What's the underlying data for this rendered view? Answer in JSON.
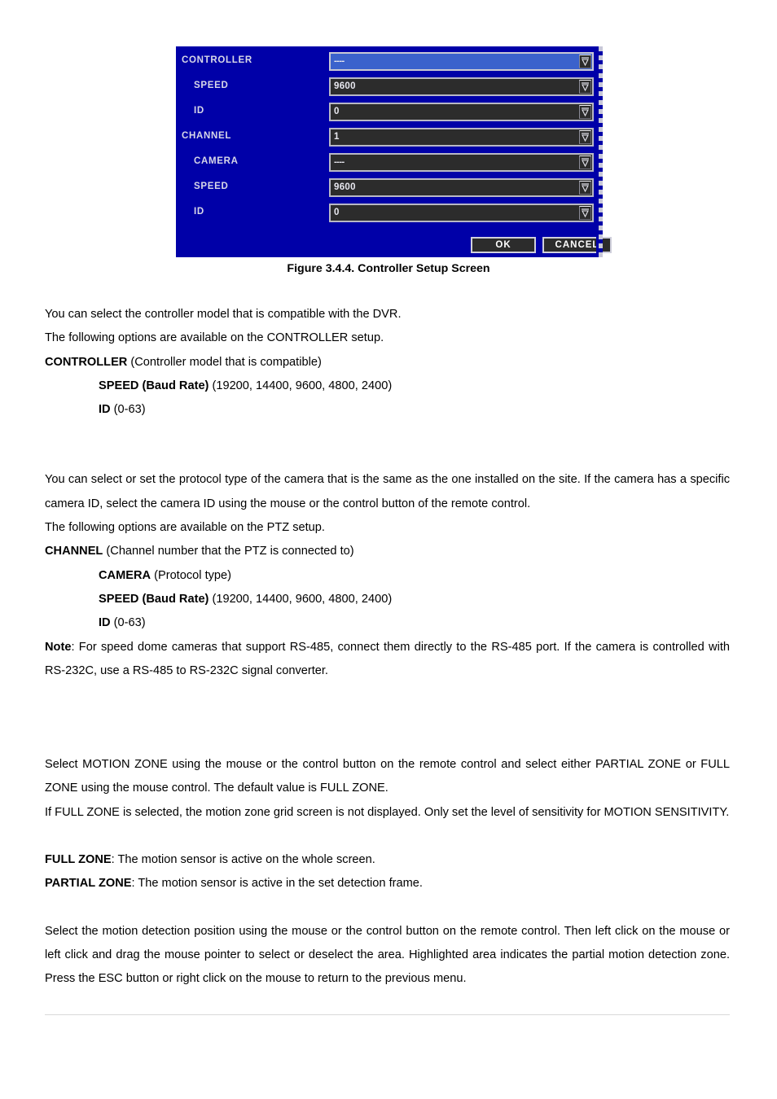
{
  "figure": {
    "caption": "Figure 3.4.4. Controller Setup Screen",
    "dialog": {
      "background_color": "#0000A8",
      "field_background_color": "#2C2C2C",
      "selected_field_color": "#3B62CC",
      "rows": [
        {
          "label": "CONTROLLER",
          "level": 0,
          "value": "----",
          "selected": true,
          "icon": "chevron-down-icon"
        },
        {
          "label": "SPEED",
          "level": 1,
          "value": "9600",
          "selected": false,
          "icon": "chevron-down-icon"
        },
        {
          "label": "ID",
          "level": 1,
          "value": "0",
          "selected": false,
          "icon": "chevron-down-icon"
        },
        {
          "label": "CHANNEL",
          "level": 0,
          "value": "1",
          "selected": false,
          "icon": "chevron-down-icon"
        },
        {
          "label": "CAMERA",
          "level": 1,
          "value": "----",
          "selected": false,
          "icon": "chevron-down-icon"
        },
        {
          "label": "SPEED",
          "level": 1,
          "value": "9600",
          "selected": false,
          "icon": "chevron-down-icon"
        },
        {
          "label": "ID",
          "level": 1,
          "value": "0",
          "selected": false,
          "icon": "chevron-down-icon"
        }
      ],
      "buttons": {
        "ok": "OK",
        "cancel": "CANCEL"
      }
    }
  },
  "body": {
    "para1_line1": "You can select the controller model that is compatible with the DVR.",
    "para1_line2": "The following options are available on the CONTROLLER setup.",
    "controller_term": "CONTROLLER",
    "controller_desc": " (Controller model that is compatible)",
    "speed_term_1": "SPEED (Baud Rate)",
    "speed_desc_1": " (19200, 14400, 9600, 4800, 2400)",
    "id_term_1": "ID",
    "id_desc_1": " (0-63)",
    "para2": "You can select or set the protocol type of the camera that is the same as the one installed on the site. If the camera has a specific camera ID, select the camera ID using the mouse or the control button of the remote control.",
    "para2_line3": "The following options are available on the PTZ setup.",
    "channel_term": "CHANNEL",
    "channel_desc": " (Channel number that the PTZ is connected to)",
    "camera_term": "CAMERA",
    "camera_desc": " (Protocol type)",
    "speed_term_2": "SPEED (Baud Rate)",
    "speed_desc_2": " (19200, 14400, 9600, 4800, 2400)",
    "id_term_2": "ID",
    "id_desc_2": " (0-63)",
    "note_term": "Note",
    "note_desc": ": For speed dome cameras that support RS-485, connect them directly to the RS-485 port. If the camera is controlled with RS-232C, use a RS-485 to RS-232C signal converter.",
    "para3_a": "Select MOTION ZONE using the mouse or the control button on the remote control and select either PARTIAL ZONE or FULL ZONE using the mouse control. The default value is FULL ZONE.",
    "para3_b": "If FULL ZONE is selected, the motion zone grid screen is not displayed. Only set the level of sensitivity for MOTION SENSITIVITY.",
    "fullzone_term": "FULL ZONE",
    "fullzone_desc": ": The motion sensor is active on the whole screen.",
    "partialzone_term": "PARTIAL ZONE",
    "partialzone_desc": ": The motion sensor is active in the set detection frame.",
    "para4": "Select the motion detection position using the mouse or the control button on the remote control. Then left click on the mouse or left click and drag the mouse pointer to select or deselect the area. Highlighted area indicates the partial motion detection zone. Press the ESC button or right click on the mouse to return to the previous menu."
  }
}
